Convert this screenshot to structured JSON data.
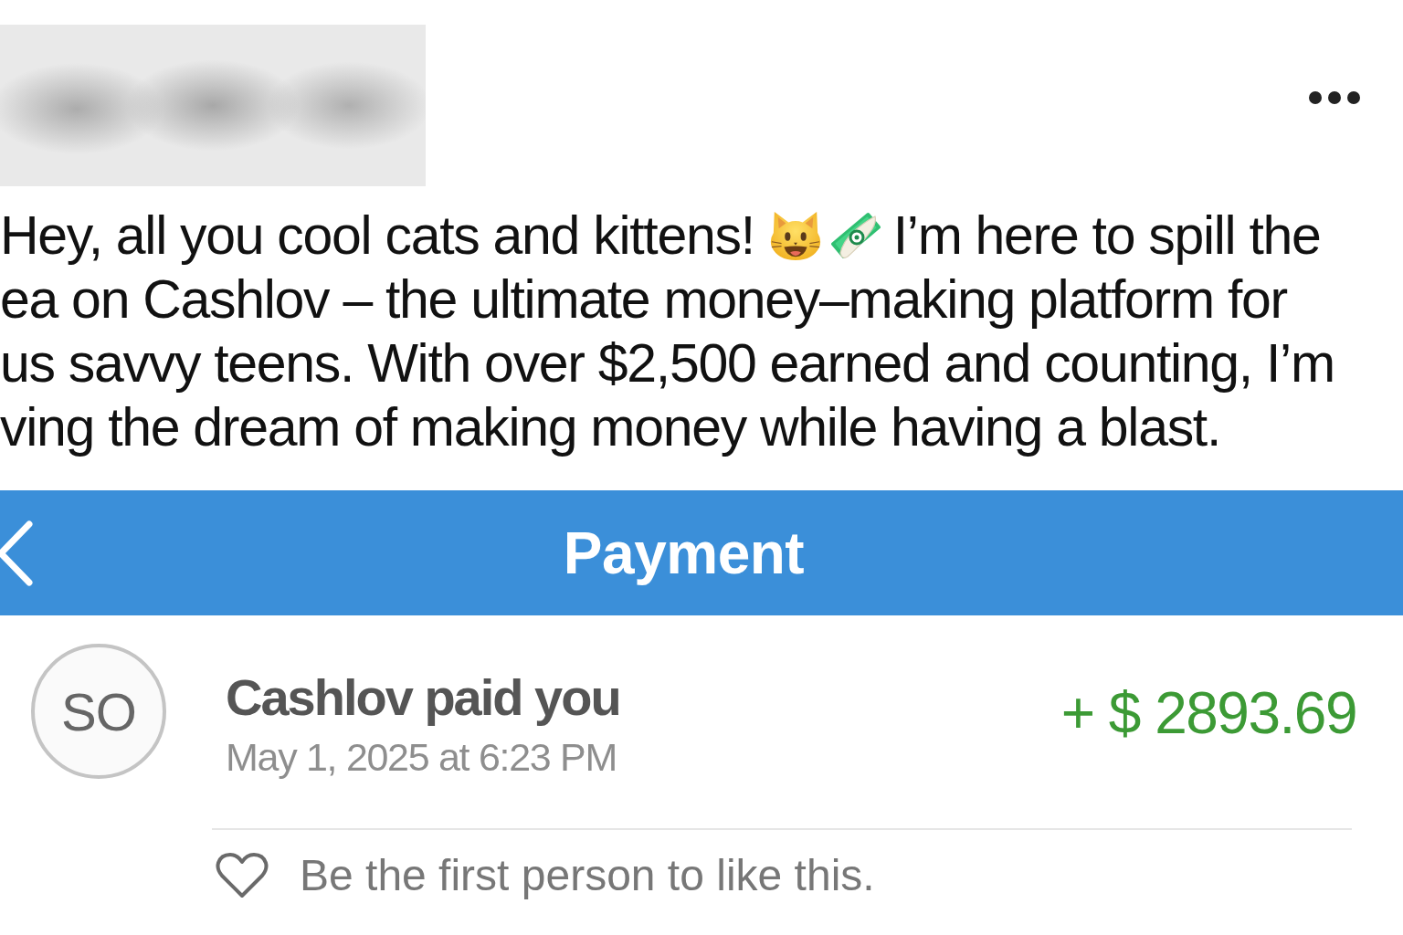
{
  "post": {
    "opening": "Hey, all you cool cats and kittens!",
    "after_emojis": "I’m here to spill the",
    "lines": [
      "ea on Cashlov – the ultimate money–making platform for",
      "us savvy teens. With over $2,500 earned and counting, I’m",
      "ving the dream of making money while having a blast."
    ]
  },
  "header": {
    "title": "Payment"
  },
  "payment": {
    "avatar_initials": "SO",
    "title": "Cashlov paid you",
    "date": "May 1, 2025 at 6:23 PM",
    "amount": "+ $ 2893.69"
  },
  "likes": {
    "text": "Be the first person to like this.",
    "liked": false
  }
}
